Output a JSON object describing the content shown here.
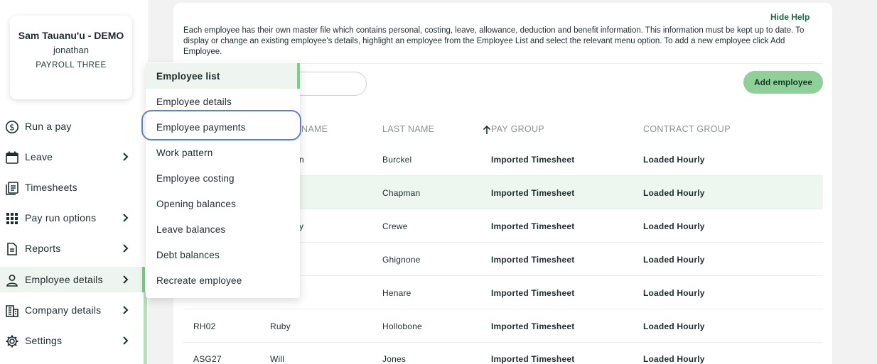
{
  "user": {
    "name": "Sam Tauanu'u - DEMO",
    "login": "jonathan",
    "company": "PAYROLL THREE"
  },
  "nav": [
    {
      "label": "Run a pay",
      "icon": "dollar-circle-icon",
      "chevron": false
    },
    {
      "label": "Leave",
      "icon": "calendar-icon",
      "chevron": true
    },
    {
      "label": "Timesheets",
      "icon": "timesheet-icon",
      "chevron": false
    },
    {
      "label": "Pay run options",
      "icon": "grid-icon",
      "chevron": true
    },
    {
      "label": "Reports",
      "icon": "report-icon",
      "chevron": true
    },
    {
      "label": "Employee details",
      "icon": "person-icon",
      "chevron": true,
      "active": true
    },
    {
      "label": "Company details",
      "icon": "building-icon",
      "chevron": true
    },
    {
      "label": "Settings",
      "icon": "gear-icon",
      "chevron": true
    }
  ],
  "help": {
    "hide_label": "Hide Help",
    "text": "Each employee has their own master file which contains personal, costing, leave, allowance, deduction and benefit information. This information must be kept up to date. To display or change an existing employee's details, highlight an employee from the Employee List and select the relevant menu option. To add a new employee click Add Employee."
  },
  "add_button": "Add employee",
  "table": {
    "headers": {
      "first": "NAME",
      "last": "LAST NAME",
      "pay": "PAY GROUP",
      "contract": "CONTRACT GROUP"
    },
    "rows": [
      {
        "code": "",
        "first": "n",
        "last": "Burckel",
        "pay": "Imported Timesheet",
        "contract": "Loaded Hourly"
      },
      {
        "code": "",
        "first": "",
        "last": "Chapman",
        "pay": "Imported Timesheet",
        "contract": "Loaded Hourly",
        "selected": true
      },
      {
        "code": "",
        "first": "y",
        "last": "Crewe",
        "pay": "Imported Timesheet",
        "contract": "Loaded Hourly"
      },
      {
        "code": "",
        "first": "",
        "last": "Ghignone",
        "pay": "Imported Timesheet",
        "contract": "Loaded Hourly"
      },
      {
        "code": "",
        "first": "",
        "last": "Henare",
        "pay": "Imported Timesheet",
        "contract": "Loaded Hourly"
      },
      {
        "code": "RH02",
        "first": "Ruby",
        "last": "Hollobone",
        "pay": "Imported Timesheet",
        "contract": "Loaded Hourly"
      },
      {
        "code": "ASG27",
        "first": "Will",
        "last": "Jones",
        "pay": "Imported Timesheet",
        "contract": "Loaded Hourly"
      }
    ]
  },
  "menu": [
    "Employee list",
    "Employee details",
    "Employee payments",
    "Work pattern",
    "Employee costing",
    "Opening balances",
    "Leave balances",
    "Debt balances",
    "Recreate employee"
  ],
  "colors": {
    "accent_green": "#7ccf86",
    "button_green": "#8fcf98",
    "focus_blue": "#5a7fd6",
    "help_link": "#1d6b45"
  }
}
